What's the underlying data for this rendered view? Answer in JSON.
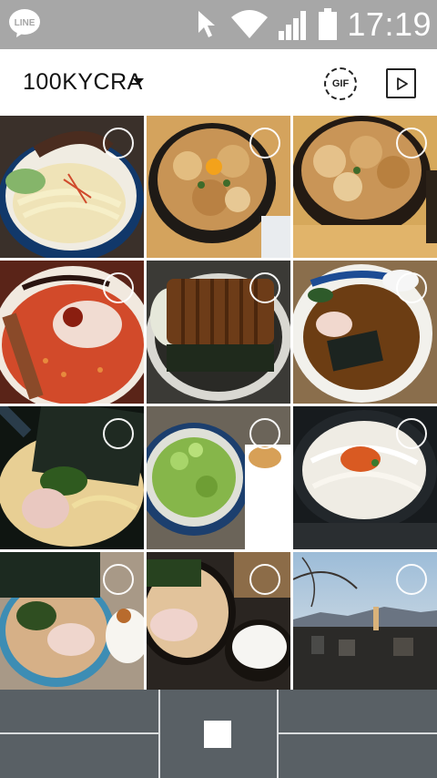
{
  "status_bar": {
    "app_badge": "LINE",
    "time": "17:19",
    "icons": [
      "line-app-icon",
      "cursor-icon",
      "wifi-icon",
      "signal-icon",
      "battery-icon"
    ]
  },
  "header": {
    "album_title": "100KYCRA",
    "gif_label": "GIF",
    "icons": [
      "dropdown-caret-icon",
      "gif-icon",
      "play-icon"
    ]
  },
  "photos": [
    {
      "subject": "ramen",
      "colors": [
        "#e8e2cf",
        "#f2e6b0",
        "#0f3b66"
      ]
    },
    {
      "subject": "pork-bowl",
      "colors": [
        "#b7843f",
        "#e8c98e",
        "#3b2a18"
      ]
    },
    {
      "subject": "pork-bowl",
      "colors": [
        "#c28c45",
        "#efd4a3",
        "#2b1f12"
      ]
    },
    {
      "subject": "spicy-ramen",
      "colors": [
        "#c9402a",
        "#e46b3b",
        "#f0d7c0"
      ]
    },
    {
      "subject": "tonkatsu",
      "colors": [
        "#6a3a18",
        "#2c2c28",
        "#d7d6cf"
      ]
    },
    {
      "subject": "shoyu-ramen",
      "colors": [
        "#6a3b14",
        "#e7e4dc",
        "#1d4c94"
      ]
    },
    {
      "subject": "iekei-ramen",
      "colors": [
        "#e9cf95",
        "#2a3c1d",
        "#0f1a12"
      ]
    },
    {
      "subject": "negi-udon",
      "colors": [
        "#8fbd4b",
        "#dfe1d9",
        "#4c4f51"
      ]
    },
    {
      "subject": "udon",
      "colors": [
        "#ece8df",
        "#d55e27",
        "#1a1f24"
      ]
    },
    {
      "subject": "iekei-ramen",
      "colors": [
        "#d9b38c",
        "#27331e",
        "#efeae3"
      ]
    },
    {
      "subject": "ramen-rice",
      "colors": [
        "#e2c49c",
        "#1f1a16",
        "#f5f5f2"
      ]
    },
    {
      "subject": "city-sunset",
      "colors": [
        "#a9c5df",
        "#f0c477",
        "#222222"
      ]
    }
  ],
  "bottom_bar": {
    "stop_icon": "stop-icon"
  },
  "colors": {
    "status_bar": "#a7a7a7",
    "bottom_bar": "#596065",
    "divider": "#d9dcde"
  }
}
